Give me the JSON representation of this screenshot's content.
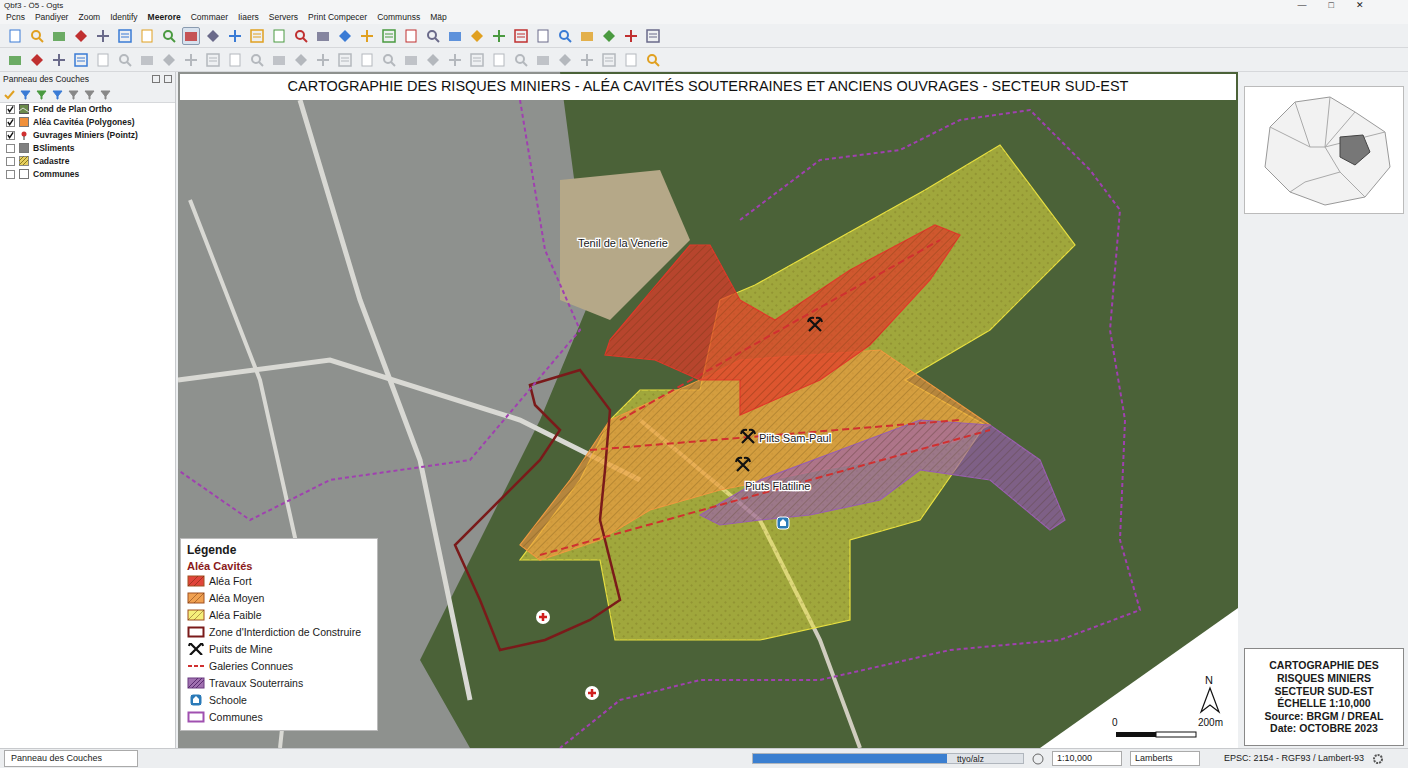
{
  "window": {
    "title": "Qbf3 - Ö5 - Ogts",
    "controls": [
      "—",
      "□",
      "✕"
    ]
  },
  "menu": [
    {
      "label": "Pcns",
      "selected": false
    },
    {
      "label": "Pandiyer",
      "selected": false
    },
    {
      "label": "Zoom",
      "selected": false
    },
    {
      "label": "Identify",
      "selected": false
    },
    {
      "label": "Meerore",
      "selected": true
    },
    {
      "label": "Commaer",
      "selected": false
    },
    {
      "label": "Iiaers",
      "selected": false
    },
    {
      "label": "Servers",
      "selected": false
    },
    {
      "label": "Print Compecer",
      "selected": false
    },
    {
      "label": "Communss",
      "selected": false
    },
    {
      "label": "Mäp",
      "selected": false
    }
  ],
  "toolbar1": [
    {
      "selected": false
    },
    {
      "selected": false
    },
    {
      "selected": false
    },
    {
      "selected": false
    },
    {
      "selected": false
    },
    {
      "selected": false
    },
    {
      "selected": false
    },
    {
      "selected": false
    },
    {
      "selected": true
    },
    {
      "selected": false
    },
    {
      "selected": false
    },
    {
      "selected": false
    },
    {
      "selected": false
    },
    {
      "selected": false
    },
    {
      "selected": false
    },
    {
      "selected": false
    },
    {
      "selected": false
    },
    {
      "selected": false
    },
    {
      "selected": false
    },
    {
      "selected": false
    },
    {
      "selected": false
    },
    {
      "selected": false
    },
    {
      "selected": false
    },
    {
      "selected": false
    },
    {
      "selected": false
    },
    {
      "selected": false
    },
    {
      "selected": false
    },
    {
      "selected": false
    },
    {
      "selected": false
    },
    {
      "selected": false
    }
  ],
  "toolbar2": [
    {
      "disabled": false
    },
    {
      "disabled": false
    },
    {
      "disabled": false
    },
    {
      "disabled": false
    },
    {
      "disabled": true
    },
    {
      "disabled": true
    },
    {
      "disabled": true
    },
    {
      "disabled": true
    },
    {
      "disabled": true
    },
    {
      "disabled": true
    },
    {
      "disabled": true
    },
    {
      "disabled": true
    },
    {
      "disabled": true
    },
    {
      "disabled": true
    },
    {
      "disabled": true
    },
    {
      "disabled": true
    },
    {
      "disabled": true
    },
    {
      "disabled": true
    },
    {
      "disabled": true
    },
    {
      "disabled": true
    },
    {
      "disabled": true
    },
    {
      "disabled": true
    },
    {
      "disabled": true
    },
    {
      "disabled": true
    },
    {
      "disabled": true
    },
    {
      "disabled": true
    },
    {
      "disabled": true
    },
    {
      "disabled": true
    },
    {
      "disabled": true
    },
    {
      "disabled": false
    }
  ],
  "layers_panel": {
    "title": "Panneau des Couches",
    "layers": [
      {
        "label": "Fond de Plan Ortho",
        "checked": true,
        "kind": "raster",
        "color": "#6a8a4a"
      },
      {
        "label": "Aléa Cavitéa (Polygones)",
        "checked": true,
        "kind": "polygon",
        "color": "#f0903a"
      },
      {
        "label": "Guvrages Miniers (Pointz)",
        "checked": true,
        "kind": "point",
        "color": "#d03030"
      },
      {
        "label": "BSliments",
        "checked": false,
        "kind": "polygon",
        "color": "#808080"
      },
      {
        "label": "Cadastre",
        "checked": false,
        "kind": "hatch",
        "color": "#e8d060"
      },
      {
        "label": "Communes",
        "checked": false,
        "kind": "polygon",
        "color": "#ffffff"
      }
    ]
  },
  "map": {
    "title": "CARTOGRAPHIE DES RISQUES MINIERS - ALÉA CAVITÉS SOUTERRAINES ET ANCIENS OUVRAGES - SECTEUR SUD-EST",
    "zones": [
      {
        "kind": "faible",
        "color": "#e8e040"
      },
      {
        "kind": "moyen",
        "color": "#f09a40"
      },
      {
        "kind": "fort",
        "color": "#e03a2a"
      },
      {
        "kind": "travaux",
        "color": "#9a60b0"
      },
      {
        "kind": "interdiction",
        "color": "#7a1a1a"
      },
      {
        "kind": "galeries",
        "color": "#d03030"
      },
      {
        "kind": "communes",
        "color": "#a040b0"
      }
    ],
    "markers": [
      {
        "kind": "pick"
      },
      {
        "kind": "pick"
      },
      {
        "kind": "pick"
      },
      {
        "kind": "school"
      },
      {
        "kind": "hospital"
      },
      {
        "kind": "hospital"
      }
    ],
    "labels": [
      {
        "text": "Tenil de la Venerie"
      },
      {
        "text": "Piits Sam-Paul"
      },
      {
        "text": "Piuts Flatiline"
      }
    ],
    "north": "N",
    "scale": {
      "start": "0",
      "end": "200m"
    }
  },
  "legend": {
    "title": "Légende",
    "subtitle": "Aléa Cavités",
    "items": [
      {
        "label": "Aléa Fort",
        "kind": "fill",
        "color": "#e0443a"
      },
      {
        "label": "Aléa Moyen",
        "kind": "fill",
        "color": "#f0a050"
      },
      {
        "label": "Aléa Faible",
        "kind": "fill",
        "color": "#f5ef7a"
      },
      {
        "label": "Zone d'Interdiction de Construire",
        "kind": "outline",
        "color": "#7a1a1a"
      },
      {
        "label": "Puits de Mine",
        "kind": "pick",
        "color": "#111111"
      },
      {
        "label": "Galeries Connues",
        "kind": "dashed",
        "color": "#d03030"
      },
      {
        "label": "Travaux Souterrains",
        "kind": "hatch",
        "color": "#a070b0"
      },
      {
        "label": "Schoole",
        "kind": "school",
        "color": "#2a7ab8"
      },
      {
        "label": "Communes",
        "kind": "outline",
        "color": "#a050b0"
      }
    ]
  },
  "info_box": [
    "CARTOGRAPHIE DES RISQUES MINIERS",
    "SECTEUR SUD-EST",
    "ÉCHELLE 1:10,000",
    "Source: BRGM / DREAL",
    "Date: OCTOBRE 2023"
  ],
  "status_bar": {
    "panel_tab": "Panneau des Couches",
    "progress": {
      "level": 0.72,
      "text": "ttyo/alz"
    },
    "scale": "1:10,000",
    "projection": "Lamberts",
    "crs": "EPSC: 2154 - RGF93 / Lambert-93"
  }
}
